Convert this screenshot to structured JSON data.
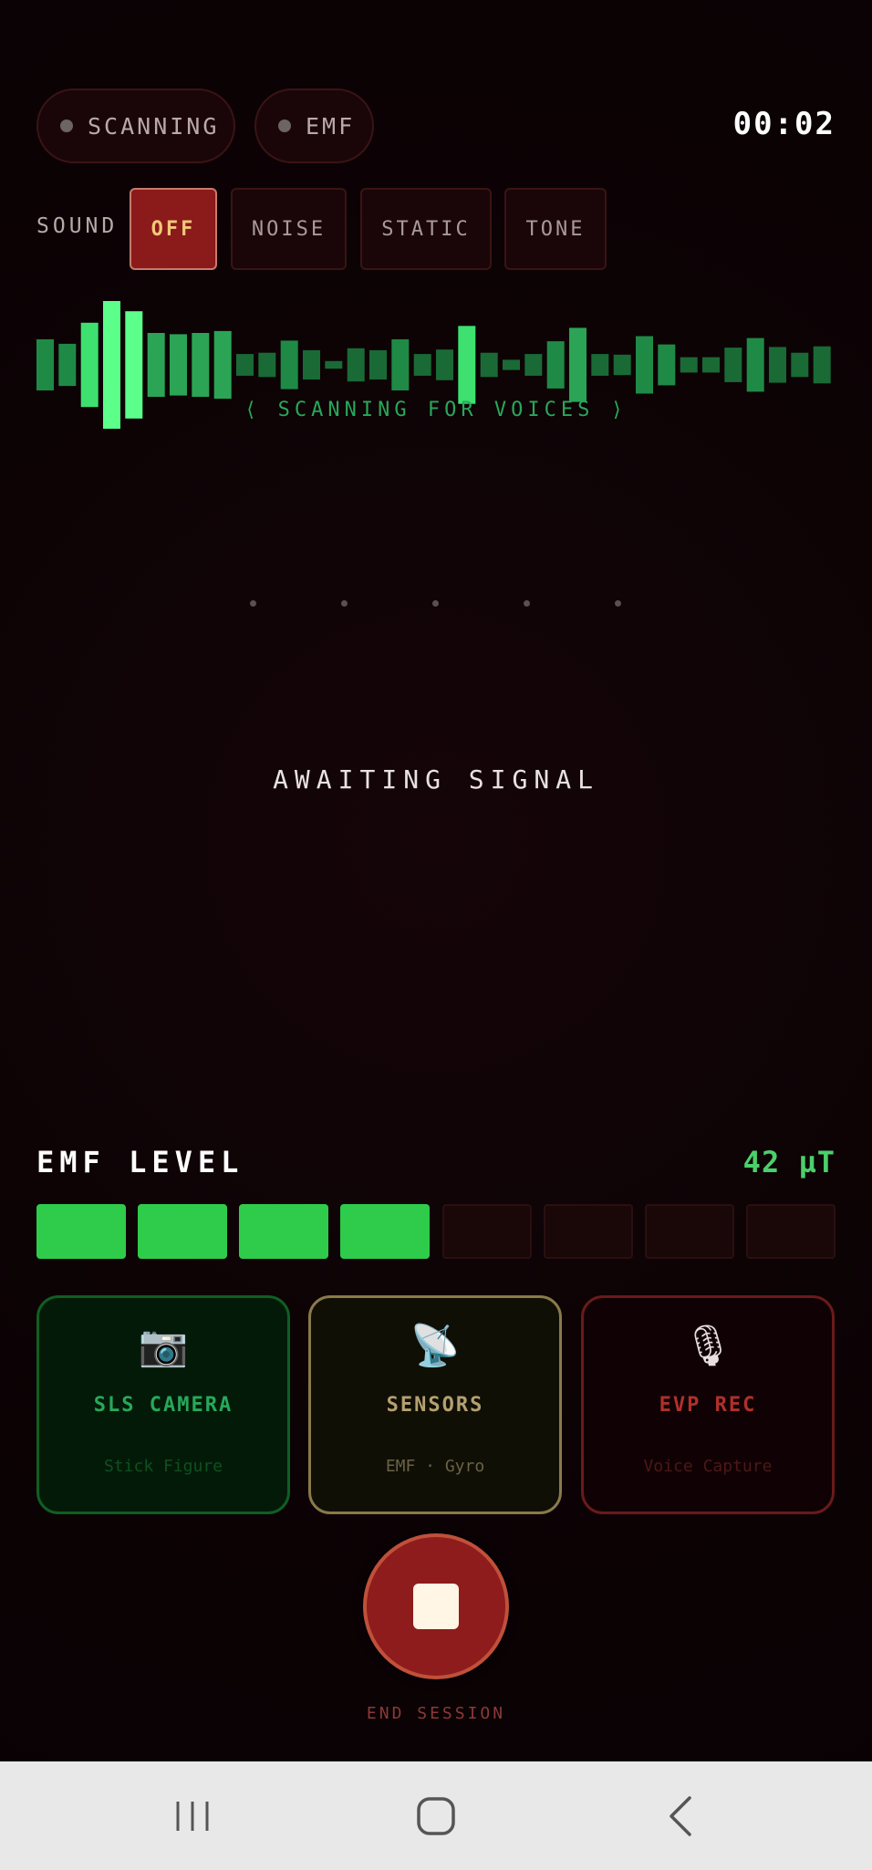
{
  "status": {
    "scanning_label": "SCANNING",
    "emf_label": "EMF",
    "timer": "00:02"
  },
  "sound": {
    "label": "SOUND",
    "options": [
      "OFF",
      "NOISE",
      "STATIC",
      "TONE"
    ],
    "selected": "OFF"
  },
  "waveform": {
    "caption": "⟨  SCANNING FOR VOICES  ⟩",
    "levels": [
      0.4,
      0.33,
      0.66,
      1.0,
      0.84,
      0.5,
      0.48,
      0.5,
      0.53,
      0.17,
      0.19,
      0.38,
      0.23,
      0.06,
      0.26,
      0.23,
      0.4,
      0.17,
      0.24,
      0.61,
      0.19,
      0.08,
      0.17,
      0.37,
      0.58,
      0.17,
      0.16,
      0.45,
      0.32,
      0.12,
      0.12,
      0.27,
      0.42,
      0.28,
      0.19,
      0.29
    ]
  },
  "main": {
    "awaiting_text": "AWAITING SIGNAL"
  },
  "emf": {
    "title": "EMF LEVEL",
    "value": "42 µT",
    "segments_total": 8,
    "segments_active": 4,
    "active_color": "#2ecc4a"
  },
  "cards": [
    {
      "icon": "camera-icon",
      "glyph": "📷",
      "title": "SLS CAMERA",
      "subtitle": "Stick Figure"
    },
    {
      "icon": "satellite-dish-icon",
      "glyph": "📡",
      "title": "SENSORS",
      "subtitle": "EMF · Gyro"
    },
    {
      "icon": "microphone-icon",
      "glyph": "🎙",
      "title": "EVP REC",
      "subtitle": "Voice Capture"
    }
  ],
  "end_session": {
    "label": "END SESSION"
  },
  "colors": {
    "accent_green": "#27a85a",
    "accent_red": "#8e1c1c",
    "background": "#0d0305"
  }
}
